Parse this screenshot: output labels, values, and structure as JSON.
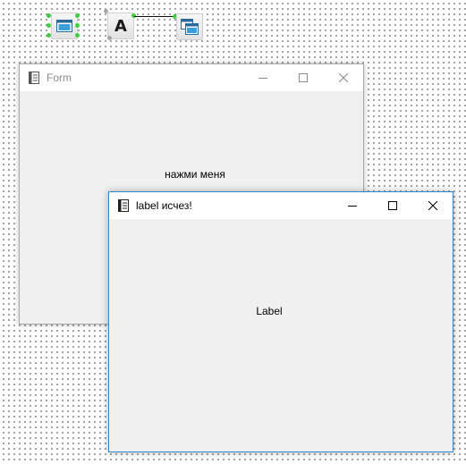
{
  "canvas": {
    "nodes": [
      {
        "name": "form-component-icon"
      },
      {
        "name": "label-component-icon",
        "glyph": "A"
      },
      {
        "name": "form-window-component-icon"
      }
    ]
  },
  "windows": {
    "form": {
      "title": "Form",
      "text": "нажми меня",
      "state": "inactive"
    },
    "label_window": {
      "title": "label исчез!",
      "text": "Label",
      "state": "active"
    }
  },
  "colors": {
    "handle": "#3dcf3d",
    "active_border": "#2c87d6",
    "window_client": "#f0f0f0"
  }
}
